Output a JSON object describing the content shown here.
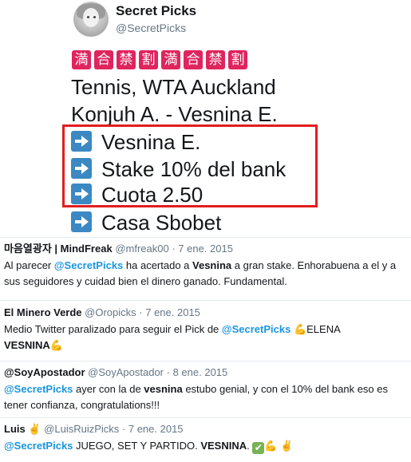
{
  "tweet": {
    "display_name": "Secret Picks",
    "handle": "@SecretPicks",
    "banner_chars": [
      "満",
      "合",
      "禁",
      "割",
      "満",
      "合",
      "禁",
      "割"
    ],
    "line1": "Tennis, WTA Auckland",
    "line2": "Konjuh A. - Vesnina E.",
    "pick": "Vesnina E.",
    "stake": "Stake 10% del bank",
    "odds": "Cuota 2.50",
    "bookmaker": "Casa Sbobet"
  },
  "replies": [
    {
      "name": "마음열광자 | MindFreak",
      "handle": "@mfreak00",
      "date": "· 7 ene. 2015",
      "text_a": "Al parecer ",
      "mention": "@SecretPicks",
      "text_b": " ha acertado a ",
      "bold": "Vesnina",
      "text_c": " a gran stake. Enhorabuena a el y a sus seguidores y cuidad bien el dinero ganado. Fundamental."
    },
    {
      "name": "El Minero Verde",
      "handle": "@Oropicks",
      "date": "· 7 ene. 2015",
      "text_a": "Medio Twitter paralizado para seguir el Pick de ",
      "mention": "@SecretPicks",
      "text_b": "ELENA",
      "bold": "VESNINA"
    },
    {
      "name": "@SoyApostador",
      "handle": "@SoyApostador",
      "date": "· 8 ene. 2015",
      "mention": "@SecretPicks",
      "text_a": " ayer con la de ",
      "bold": "vesnina",
      "text_b": " estubo genial, y con el 10% del bank eso es tener confianza, congratulations!!!"
    },
    {
      "name": "Luis",
      "handle": "@LuisRuizPicks",
      "date": "· 7 ene. 2015",
      "mention": "@SecretPicks",
      "text_a": " JUEGO, SET Y PARTIDO. ",
      "bold": "VESNINA",
      "text_b": "."
    }
  ],
  "colors": {
    "mention": "#1b95e0",
    "highlight_box": "#e31d1d",
    "arrow_icon": "#3b88c3",
    "banner": "#e0245e"
  },
  "icons": [
    "arrow-right-icon",
    "flexed-biceps-icon",
    "check-mark-icon",
    "victory-hand-icon"
  ]
}
